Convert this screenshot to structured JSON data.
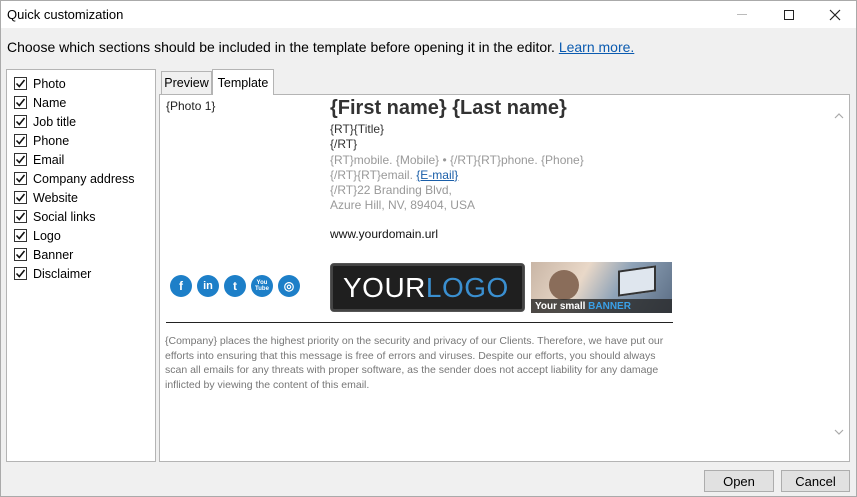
{
  "window": {
    "title": "Quick customization"
  },
  "instruction": {
    "text": "Choose which sections should be included in the template before opening it in the editor.",
    "link": "Learn more."
  },
  "sections": [
    {
      "label": "Photo",
      "checked": true
    },
    {
      "label": "Name",
      "checked": true
    },
    {
      "label": "Job title",
      "checked": true
    },
    {
      "label": "Phone",
      "checked": true
    },
    {
      "label": "Email",
      "checked": true
    },
    {
      "label": "Company address",
      "checked": true
    },
    {
      "label": "Website",
      "checked": true
    },
    {
      "label": "Social links",
      "checked": true
    },
    {
      "label": "Logo",
      "checked": true
    },
    {
      "label": "Banner",
      "checked": true
    },
    {
      "label": "Disclaimer",
      "checked": true
    }
  ],
  "tabs": {
    "preview": "Preview",
    "template": "Template",
    "active": "Template"
  },
  "template": {
    "photo": "{Photo 1}",
    "name": "{First name} {Last name}",
    "title": "{RT}{Title}",
    "rt_close": "{/RT}",
    "phone_line": "{RT}mobile. {Mobile} • {/RT}{RT}phone. {Phone}",
    "email_prefix": "{/RT}{RT}email. ",
    "email_link": "{E-mail}",
    "address1": "{/RT}22 Branding Blvd,",
    "address2": "Azure Hill, NV, 89404, USA",
    "website": "www.yourdomain.url",
    "social": [
      {
        "icon": "facebook-icon",
        "glyph": "f"
      },
      {
        "icon": "linkedin-icon",
        "glyph": "in"
      },
      {
        "icon": "twitter-icon",
        "glyph": "t"
      },
      {
        "icon": "youtube-icon",
        "glyph": "You Tube"
      },
      {
        "icon": "instagram-icon",
        "glyph": "◎"
      }
    ],
    "logo_your": "YOUR",
    "logo_logo": "LOGO",
    "banner_text": "Your small",
    "banner_highlight": "BANNER",
    "disclaimer": "{Company} places the highest priority on the security and privacy of our Clients. Therefore, we have put our efforts into ensuring that this message is free of errors and viruses. Despite our efforts, you should always scan all emails for any threats with proper software, as the sender does not accept liability for any damage inflicted by viewing the content of this email."
  },
  "buttons": {
    "open": "Open",
    "cancel": "Cancel"
  },
  "colors": {
    "accent": "#1d7fc8",
    "link": "#0b5bb0"
  }
}
